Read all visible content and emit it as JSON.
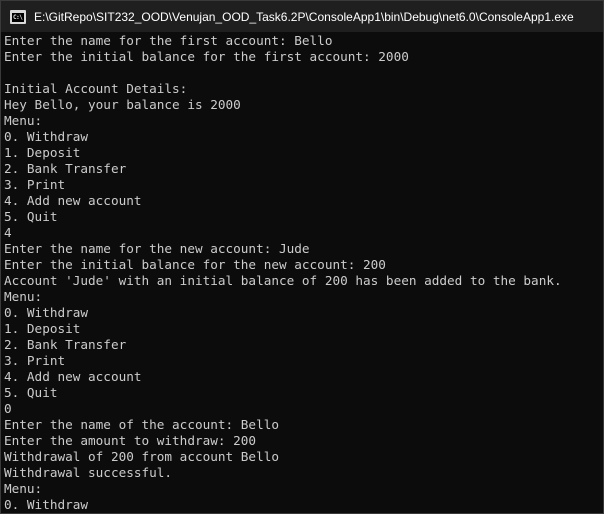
{
  "window": {
    "title": "E:\\GitRepo\\SIT232_OOD\\Venujan_OOD_Task6.2P\\ConsoleApp1\\bin\\Debug\\net6.0\\ConsoleApp1.exe",
    "icon": "console-app-icon",
    "icon_text": "C:\\"
  },
  "colors": {
    "background": "#0c0c0c",
    "text": "#cccccc",
    "titlebar": "#1f1f1f"
  },
  "console": {
    "lines": [
      "Enter the name for the first account: Bello",
      "Enter the initial balance for the first account: 2000",
      "",
      "Initial Account Details:",
      "Hey Bello, your balance is 2000",
      "Menu:",
      "0. Withdraw",
      "1. Deposit",
      "2. Bank Transfer",
      "3. Print",
      "4. Add new account",
      "5. Quit",
      "4",
      "Enter the name for the new account: Jude",
      "Enter the initial balance for the new account: 200",
      "Account 'Jude' with an initial balance of 200 has been added to the bank.",
      "Menu:",
      "0. Withdraw",
      "1. Deposit",
      "2. Bank Transfer",
      "3. Print",
      "4. Add new account",
      "5. Quit",
      "0",
      "Enter the name of the account: Bello",
      "Enter the amount to withdraw: 200",
      "Withdrawal of 200 from account Bello",
      "Withdrawal successful.",
      "Menu:",
      "0. Withdraw"
    ]
  }
}
